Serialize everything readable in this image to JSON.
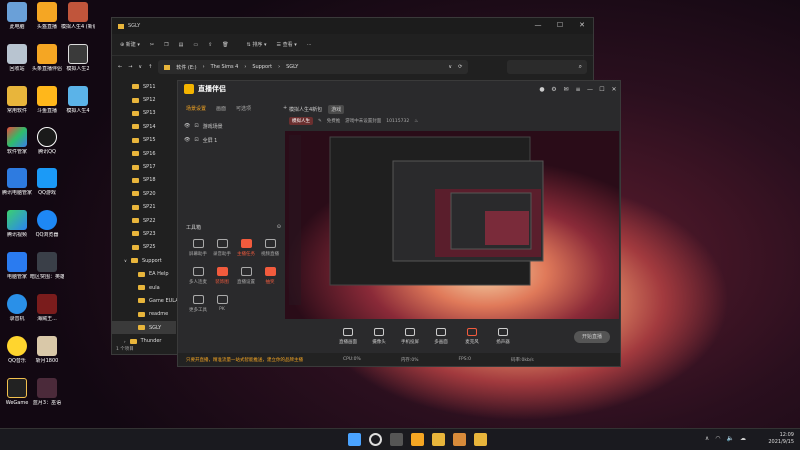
{
  "desktop": {
    "col1": [
      {
        "label": "此电脑"
      },
      {
        "label": "回收站"
      },
      {
        "label": "常用软件"
      },
      {
        "label": "软件管家"
      },
      {
        "label": "腾讯电脑管家"
      },
      {
        "label": "腾讯视频"
      },
      {
        "label": "电脑管家"
      },
      {
        "label": "录音机"
      },
      {
        "label": "QQ音乐"
      },
      {
        "label": "WeGame"
      }
    ],
    "col2": [
      {
        "label": "头盔直播"
      },
      {
        "label": "头条直播伴侣"
      },
      {
        "label": "斗鱼直播"
      },
      {
        "label": "腾讯QQ"
      },
      {
        "label": "QQ游戏"
      },
      {
        "label": "QQ浏览器"
      },
      {
        "label": "暗区突围：英雄联盟"
      },
      {
        "label": "海贼王..."
      },
      {
        "label": "斩月1800"
      },
      {
        "label": "蓝月3：巫语"
      }
    ],
    "col3": [
      {
        "label": "模拟人生4 (新版)"
      },
      {
        "label": "模拟人生2"
      },
      {
        "label": "模拟人生4"
      }
    ]
  },
  "explorer": {
    "title": "SGLY",
    "new_label": "新建",
    "sort_label": "排序",
    "view_label": "查看",
    "breadcrumb": [
      "软件 (E:)",
      "The Sims 4",
      "Support",
      "SGLY"
    ],
    "folders": [
      "SP11",
      "SP12",
      "SP13",
      "SP14",
      "SP15",
      "SP16",
      "SP17",
      "SP18",
      "SP20",
      "SP21",
      "SP22",
      "SP23",
      "SP25",
      "Support",
      "EA Help",
      "eula",
      "Game EULA",
      "readme",
      "SGLY",
      "Thunder"
    ],
    "selected_folder": "SGLY",
    "status": "1 个项目"
  },
  "app": {
    "name": "直播伴侣",
    "left_tabs": [
      "场景设置",
      "画面",
      "可选项"
    ],
    "scenes": [
      "游戏场景",
      "全屏 1"
    ],
    "tools_title": "工具箱",
    "tools": [
      "屏幕助手",
      "录音助手",
      "主播任务",
      "视频直播",
      "多人连麦",
      "装饰图",
      "直播设置",
      "抽奖",
      "更多工具",
      "PK"
    ],
    "game_title": "模拟人生4新包",
    "game_tag": "游戏",
    "info_tag": "模拟人生",
    "info_label": "免费推",
    "info_text": "游戏中未设置封面",
    "info_count": "10115732",
    "bottom_buttons": [
      "直播画面",
      "摄像头",
      "手机投屏",
      "多画面",
      "麦克风",
      "扬声器"
    ],
    "start_label": "开始直播",
    "footer": [
      "只要开直播，精准流量一站式智能推送，建立你的品牌主播",
      "CPU:0%",
      "内存:0%",
      "FPS:0",
      "码率:0kb/s"
    ]
  },
  "taskbar": {
    "time": "12:09",
    "date": "2021/9/15"
  }
}
